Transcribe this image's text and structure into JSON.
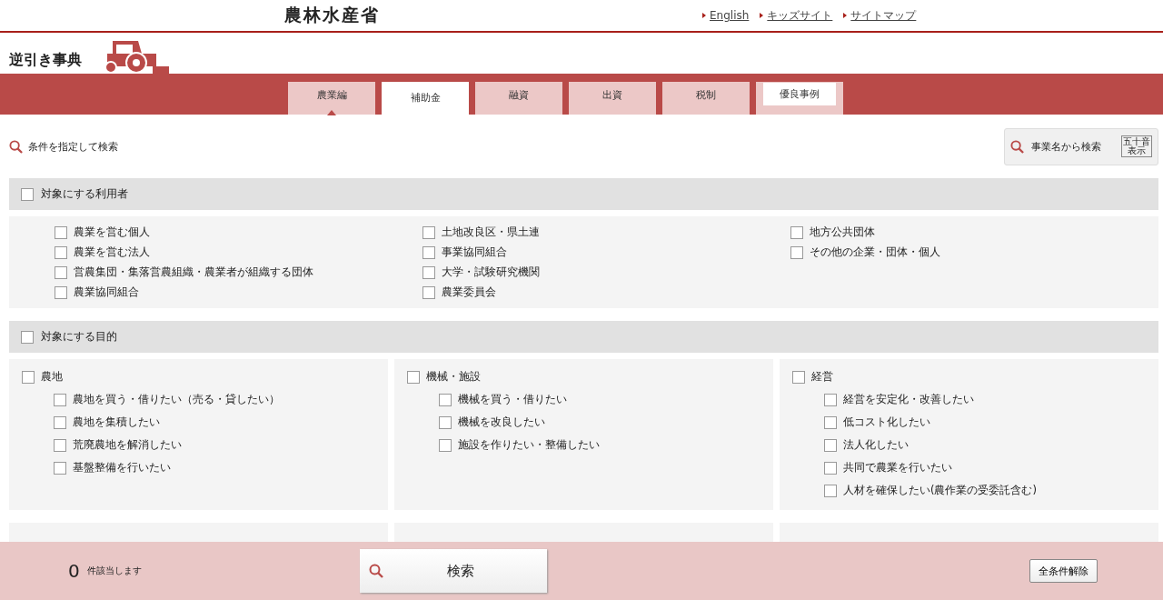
{
  "header": {
    "logo": "農林水産省",
    "links": [
      "English",
      "キッズサイト",
      "サイトマップ"
    ]
  },
  "title": "逆引き事典",
  "tabs": [
    {
      "label": "農業編",
      "selected": false,
      "pointer": true,
      "kind": "plain"
    },
    {
      "label": "補助金",
      "selected": true,
      "pointer": false,
      "kind": "plain"
    },
    {
      "label": "融資",
      "selected": false,
      "pointer": false,
      "kind": "plain"
    },
    {
      "label": "出資",
      "selected": false,
      "pointer": false,
      "kind": "plain"
    },
    {
      "label": "税制",
      "selected": false,
      "pointer": false,
      "kind": "plain"
    },
    {
      "label": "優良事例",
      "selected": false,
      "pointer": false,
      "kind": "boxed"
    }
  ],
  "search_heading": "条件を指定して検索",
  "name_search": {
    "label": "事業名から検索",
    "badge": [
      "五十音",
      "表示"
    ]
  },
  "users": {
    "label": "対象にする利用者",
    "checked": false,
    "columns": [
      [
        {
          "label": "農業を営む個人",
          "checked": false
        },
        {
          "label": "農業を営む法人",
          "checked": false
        },
        {
          "label": "営農集団・集落営農組織・農業者が組織する団体",
          "checked": false
        },
        {
          "label": "農業協同組合",
          "checked": false
        }
      ],
      [
        {
          "label": "土地改良区・県土連",
          "checked": false
        },
        {
          "label": "事業協同組合",
          "checked": false
        },
        {
          "label": "大学・試験研究機関",
          "checked": false
        },
        {
          "label": "農業委員会",
          "checked": false
        }
      ],
      [
        {
          "label": "地方公共団体",
          "checked": false
        },
        {
          "label": "その他の企業・団体・個人",
          "checked": false
        }
      ]
    ]
  },
  "purposes": {
    "label": "対象にする目的",
    "checked": false,
    "groups": [
      {
        "label": "農地",
        "checked": false,
        "children": [
          {
            "label": "農地を買う・借りたい（売る・貸したい）",
            "checked": false
          },
          {
            "label": "農地を集積したい",
            "checked": false
          },
          {
            "label": "荒廃農地を解消したい",
            "checked": false
          },
          {
            "label": "基盤整備を行いたい",
            "checked": false
          }
        ]
      },
      {
        "label": "機械・施設",
        "checked": false,
        "children": [
          {
            "label": "機械を買う・借りたい",
            "checked": false
          },
          {
            "label": "機械を改良したい",
            "checked": false
          },
          {
            "label": "施設を作りたい・整備したい",
            "checked": false
          }
        ]
      },
      {
        "label": "経営",
        "checked": false,
        "children": [
          {
            "label": "経営を安定化・改善したい",
            "checked": false
          },
          {
            "label": "低コスト化したい",
            "checked": false
          },
          {
            "label": "法人化したい",
            "checked": false
          },
          {
            "label": "共同で農業を行いたい",
            "checked": false
          },
          {
            "label": "人材を確保したい(農作業の受委託含む)",
            "checked": false
          }
        ]
      }
    ]
  },
  "footer": {
    "count": "0",
    "count_label": "件該当します",
    "search_button": "検索",
    "clear_button": "全条件解除"
  }
}
